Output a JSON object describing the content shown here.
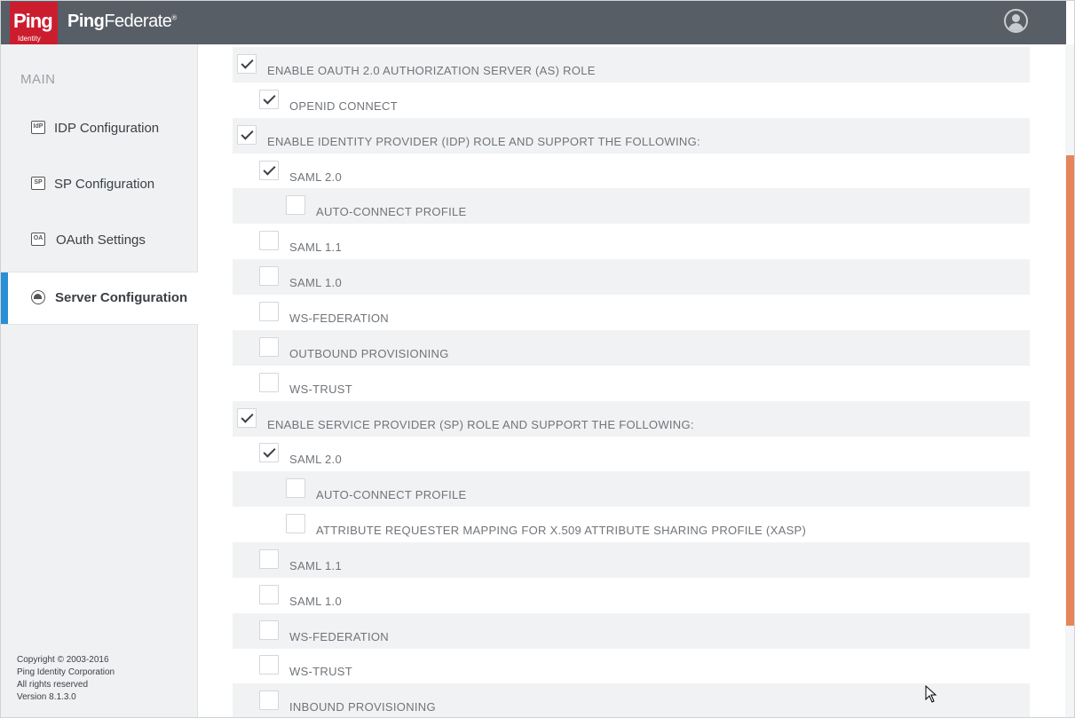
{
  "app": {
    "logo_text": "Ping",
    "logo_sub": "Identity",
    "product_name_bold": "Ping",
    "product_name_rest": "Federate",
    "product_mark": "®"
  },
  "sidebar": {
    "section_title": "MAIN",
    "items": [
      {
        "label": "IDP Configuration",
        "icon": "IdP",
        "icon_name": "idp-icon"
      },
      {
        "label": "SP Configuration",
        "icon": "SP",
        "icon_name": "sp-icon"
      },
      {
        "label": "OAuth Settings",
        "icon": "OA",
        "icon_name": "oauth-icon"
      },
      {
        "label": "Server Configuration",
        "icon": "",
        "icon_name": "server-icon",
        "active": true
      }
    ],
    "footer": {
      "line1": "Copyright © 2003-2016",
      "line2": "Ping Identity Corporation",
      "line3": "All rights reserved",
      "line4": "Version 8.1.3.0"
    }
  },
  "roles": [
    {
      "label": "ENABLE OAUTH 2.0 AUTHORIZATION SERVER (AS) ROLE",
      "checked": true,
      "level": 0
    },
    {
      "label": "OPENID CONNECT",
      "checked": true,
      "level": 1
    },
    {
      "label": "ENABLE IDENTITY PROVIDER (IDP) ROLE AND SUPPORT THE FOLLOWING:",
      "checked": true,
      "level": 0
    },
    {
      "label": "SAML 2.0",
      "checked": true,
      "level": 1
    },
    {
      "label": "AUTO-CONNECT PROFILE",
      "checked": false,
      "level": 2
    },
    {
      "label": "SAML 1.1",
      "checked": false,
      "level": 1
    },
    {
      "label": "SAML 1.0",
      "checked": false,
      "level": 1
    },
    {
      "label": "WS-FEDERATION",
      "checked": false,
      "level": 1
    },
    {
      "label": "OUTBOUND PROVISIONING",
      "checked": false,
      "level": 1
    },
    {
      "label": "WS-TRUST",
      "checked": false,
      "level": 1
    },
    {
      "label": "ENABLE SERVICE PROVIDER (SP) ROLE AND SUPPORT THE FOLLOWING:",
      "checked": true,
      "level": 0
    },
    {
      "label": "SAML 2.0",
      "checked": true,
      "level": 1
    },
    {
      "label": "AUTO-CONNECT PROFILE",
      "checked": false,
      "level": 2
    },
    {
      "label": "ATTRIBUTE REQUESTER MAPPING FOR X.509 ATTRIBUTE SHARING PROFILE (XASP)",
      "checked": false,
      "level": 2
    },
    {
      "label": "SAML 1.1",
      "checked": false,
      "level": 1
    },
    {
      "label": "SAML 1.0",
      "checked": false,
      "level": 1
    },
    {
      "label": "WS-FEDERATION",
      "checked": false,
      "level": 1
    },
    {
      "label": "WS-TRUST",
      "checked": false,
      "level": 1
    },
    {
      "label": "INBOUND PROVISIONING",
      "checked": false,
      "level": 1
    }
  ],
  "colors": {
    "header_bg": "#575e66",
    "logo_red": "#cc1d2f",
    "active_accent": "#2a8fd4",
    "scroll_thumb": "#e7845a"
  }
}
